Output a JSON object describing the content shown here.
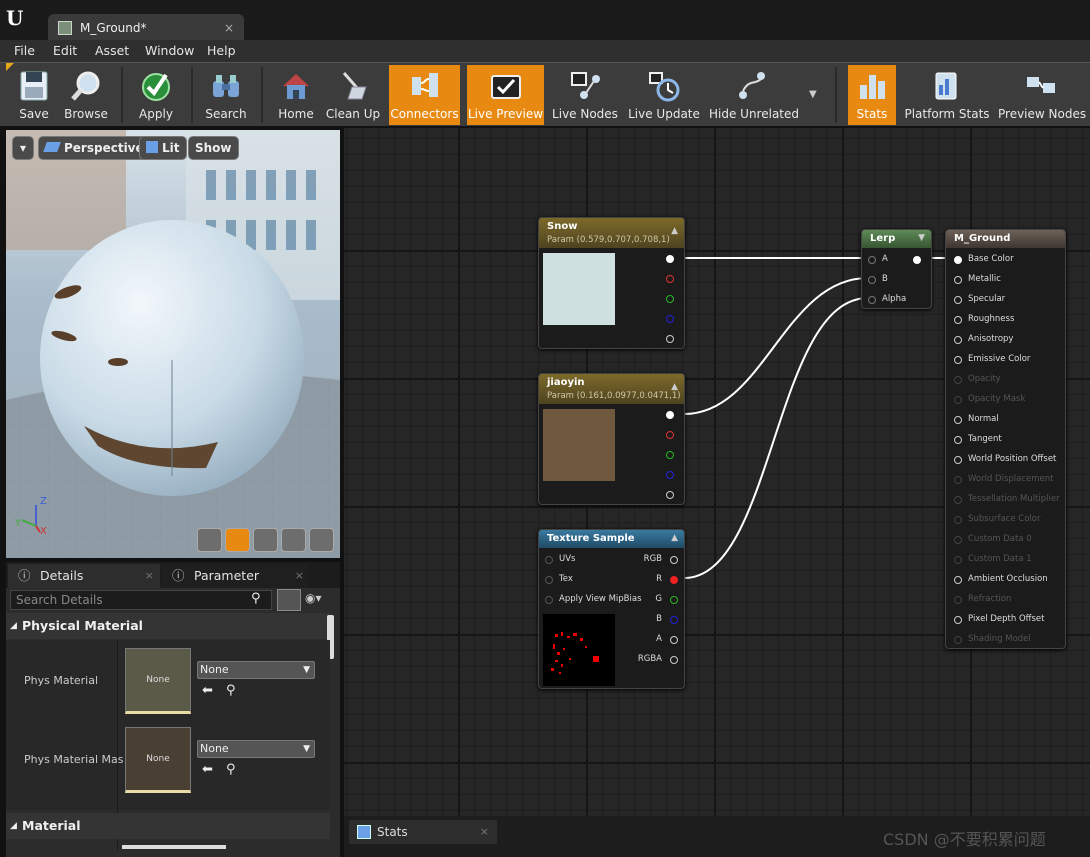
{
  "titlebar": {
    "doc_tab": "M_Ground*",
    "close": "×"
  },
  "menu": [
    "File",
    "Edit",
    "Asset",
    "Window",
    "Help"
  ],
  "toolbar": {
    "items": [
      {
        "label": "Save",
        "icon": "save-icon",
        "active": false
      },
      {
        "label": "Browse",
        "icon": "browse-icon",
        "active": false
      },
      {
        "label": "Apply",
        "icon": "apply-icon",
        "active": false
      },
      {
        "label": "Search",
        "icon": "search-icon",
        "active": false
      },
      {
        "label": "Home",
        "icon": "home-icon",
        "active": false
      },
      {
        "label": "Clean Up",
        "icon": "clean-up-icon",
        "active": false
      },
      {
        "label": "Connectors",
        "icon": "connectors-icon",
        "active": true
      },
      {
        "label": "Live Preview",
        "icon": "live-preview-icon",
        "active": true
      },
      {
        "label": "Live Nodes",
        "icon": "live-nodes-icon",
        "active": false
      },
      {
        "label": "Live Update",
        "icon": "live-update-icon",
        "active": false
      },
      {
        "label": "Hide Unrelated",
        "icon": "hide-unrelated-icon",
        "active": false
      },
      {
        "label": "Stats",
        "icon": "stats-icon",
        "active": true
      },
      {
        "label": "Platform Stats",
        "icon": "platform-stats-icon",
        "active": false
      },
      {
        "label": "Preview Nodes",
        "icon": "preview-nodes-icon",
        "active": false
      }
    ]
  },
  "viewport": {
    "perspective": "Perspective",
    "lit": "Lit",
    "show": "Show",
    "axis_z": "Z",
    "axis_y": "Y",
    "axis_x": "X"
  },
  "panel": {
    "tab_details": "Details",
    "tab_params": "Parameter Defaults",
    "search_placeholder": "Search Details",
    "cat_physical": "Physical Material",
    "phys_material": "Phys Material",
    "phys_material_mask": "Phys Material Mas",
    "thumb_none": "None",
    "combo_none": "None",
    "cat_material": "Material"
  },
  "nodes": {
    "snow": {
      "title": "Snow",
      "sub": "Param (0.579,0.707,0.708,1)",
      "swatch": "#cfe0e0"
    },
    "jiaoyin": {
      "title": "jiaoyin",
      "sub": "Param (0.161,0.0977,0.0471,1)",
      "swatch": "#70583f"
    },
    "texture": {
      "title": "Texture Sample",
      "inputs": [
        "UVs",
        "Tex",
        "Apply View MipBias"
      ],
      "outputs": [
        "RGB",
        "R",
        "G",
        "B",
        "A",
        "RGBA"
      ]
    },
    "lerp": {
      "title": "Lerp",
      "inputs": [
        "A",
        "B",
        "Alpha"
      ]
    },
    "mground": {
      "title": "M_Ground",
      "pins": [
        {
          "label": "Base Color",
          "on": true
        },
        {
          "label": "Metallic",
          "on": true
        },
        {
          "label": "Specular",
          "on": true
        },
        {
          "label": "Roughness",
          "on": true
        },
        {
          "label": "Anisotropy",
          "on": true
        },
        {
          "label": "Emissive Color",
          "on": true
        },
        {
          "label": "Opacity",
          "on": false
        },
        {
          "label": "Opacity Mask",
          "on": false
        },
        {
          "label": "Normal",
          "on": true
        },
        {
          "label": "Tangent",
          "on": true
        },
        {
          "label": "World Position Offset",
          "on": true
        },
        {
          "label": "World Displacement",
          "on": false
        },
        {
          "label": "Tessellation Multiplier",
          "on": false
        },
        {
          "label": "Subsurface Color",
          "on": false
        },
        {
          "label": "Custom Data 0",
          "on": false
        },
        {
          "label": "Custom Data 1",
          "on": false
        },
        {
          "label": "Ambient Occlusion",
          "on": true
        },
        {
          "label": "Refraction",
          "on": false
        },
        {
          "label": "Pixel Depth Offset",
          "on": true
        },
        {
          "label": "Shading Model",
          "on": false
        }
      ]
    }
  },
  "bottom": {
    "stats_tab": "Stats",
    "watermark": "CSDN @不要积累问题"
  }
}
